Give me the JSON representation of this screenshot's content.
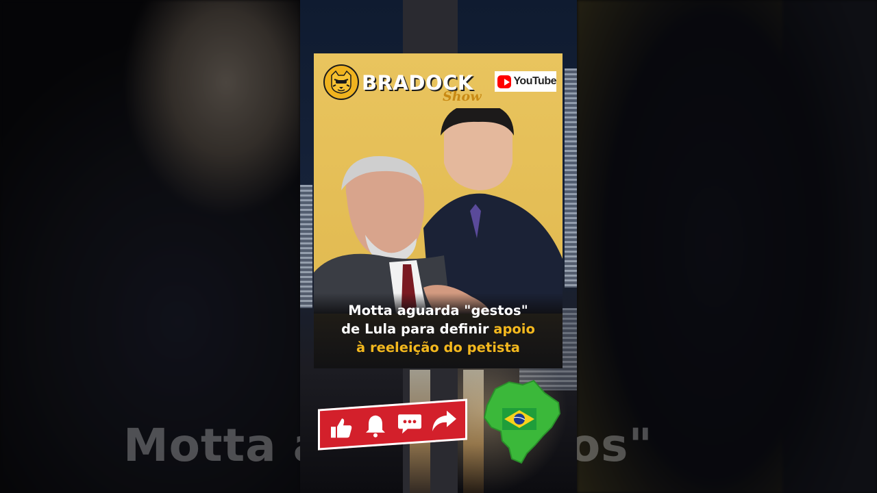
{
  "background": {
    "caption_left": "Motta a",
    "caption_right": "gestos\""
  },
  "card": {
    "brand_name": "BRADOCK",
    "brand_sub": "Show",
    "youtube_label": "YouTube",
    "headline_line1": "Motta aguarda \"gestos\"",
    "headline_line2_pre": "de Lula para definir ",
    "headline_line2_accent": "apoio",
    "headline_line3": "à reeleição do petista"
  },
  "icons": {
    "logo": "tiger-logo-icon",
    "youtube": "youtube-icon",
    "like": "thumbs-up-icon",
    "bell": "bell-icon",
    "comment": "comment-icon",
    "share": "share-arrow-icon",
    "map": "brazil-map-icon"
  },
  "colors": {
    "card_background": "#e2bb52",
    "accent_yellow": "#f3b81e",
    "action_red": "#d3202b",
    "map_green": "#3bb83a",
    "youtube_red": "#ff0000"
  }
}
